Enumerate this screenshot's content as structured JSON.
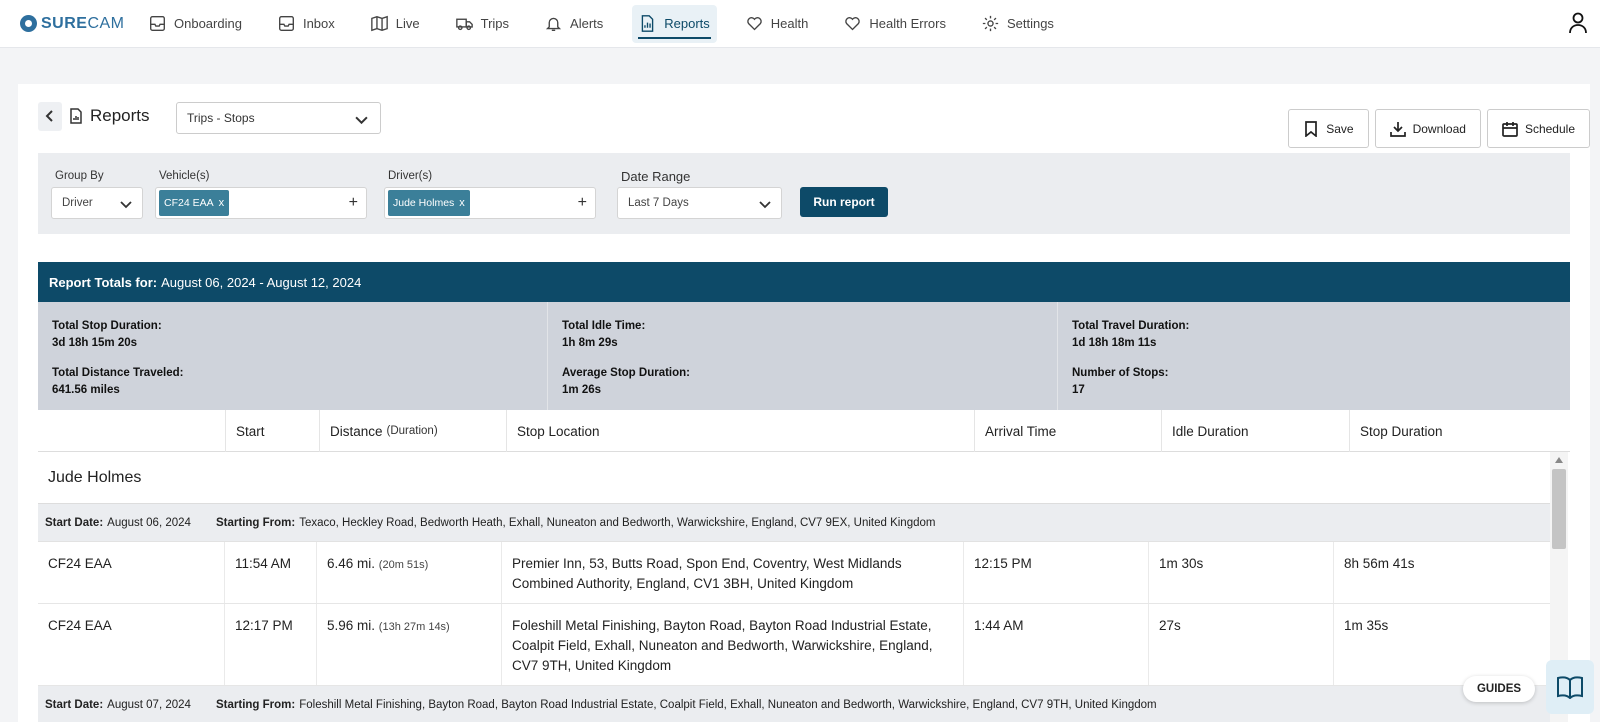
{
  "brand": {
    "name_bold": "SURE",
    "name_rest": "CAM"
  },
  "nav": [
    {
      "label": "Onboarding",
      "icon": "inbox-icon"
    },
    {
      "label": "Inbox",
      "icon": "inbox-icon"
    },
    {
      "label": "Live",
      "icon": "map-icon"
    },
    {
      "label": "Trips",
      "icon": "truck-icon"
    },
    {
      "label": "Alerts",
      "icon": "bell-icon"
    },
    {
      "label": "Reports",
      "icon": "report-icon",
      "active": true
    },
    {
      "label": "Health",
      "icon": "heart-icon"
    },
    {
      "label": "Health Errors",
      "icon": "heart-icon"
    },
    {
      "label": "Settings",
      "icon": "gear-icon"
    }
  ],
  "page": {
    "title": "Reports",
    "report_type": "Trips - Stops"
  },
  "actions": {
    "save": "Save",
    "download": "Download",
    "schedule": "Schedule"
  },
  "filters": {
    "group_by_label": "Group By",
    "group_by_value": "Driver",
    "vehicles_label": "Vehicle(s)",
    "vehicle_chip": "CF24 EAA",
    "drivers_label": "Driver(s)",
    "driver_chip": "Jude Holmes",
    "date_range_label": "Date Range",
    "date_range_value": "Last 7 Days",
    "run_label": "Run report",
    "chip_remove": "x",
    "add": "+"
  },
  "totals": {
    "heading_label": "Report Totals for:",
    "heading_range": "August 06, 2024 - August 12, 2024",
    "total_stop_duration_label": "Total Stop Duration:",
    "total_stop_duration": "3d 18h 15m 20s",
    "total_distance_label": "Total Distance Traveled:",
    "total_distance": "641.56 miles",
    "total_idle_label": "Total Idle Time:",
    "total_idle": "1h 8m 29s",
    "avg_stop_label": "Average Stop Duration:",
    "avg_stop": "1m 26s",
    "total_travel_label": "Total Travel Duration:",
    "total_travel": "1d 18h 18m 11s",
    "num_stops_label": "Number of Stops:",
    "num_stops": "17"
  },
  "table": {
    "columns": {
      "start": "Start",
      "distance": "Distance",
      "distance_sub": "(Duration)",
      "stop_location": "Stop Location",
      "arrival": "Arrival Time",
      "idle": "Idle Duration",
      "stop": "Stop Duration"
    },
    "group_name": "Jude Holmes",
    "start_date_label": "Start Date:",
    "starting_from_label": "Starting From:",
    "day1": {
      "start_date": "August 06, 2024",
      "starting_from": "Texaco, Heckley Road, Bedworth Heath, Exhall, Nuneaton and Bedworth, Warwickshire, England, CV7 9EX, United Kingdom"
    },
    "rows": [
      {
        "vehicle": "CF24 EAA",
        "start": "11:54 AM",
        "distance": "6.46 mi.",
        "duration": "(20m 51s)",
        "location": "Premier Inn, 53, Butts Road, Spon End, Coventry, West Midlands Combined Authority, England, CV1 3BH, United Kingdom",
        "arrival": "12:15 PM",
        "idle": "1m 30s",
        "stop": "8h 56m 41s"
      },
      {
        "vehicle": "CF24 EAA",
        "start": "12:17 PM",
        "distance": "5.96 mi.",
        "duration": "(13h 27m 14s)",
        "location": "Foleshill Metal Finishing, Bayton Road, Bayton Road Industrial Estate, Coalpit Field, Exhall, Nuneaton and Bedworth, Warwickshire, England, CV7 9TH, United Kingdom",
        "arrival": "1:44 AM",
        "idle": "27s",
        "stop": "1m 35s"
      }
    ],
    "day2": {
      "start_date": "August 07, 2024",
      "starting_from": "Foleshill Metal Finishing, Bayton Road, Bayton Road Industrial Estate, Coalpit Field, Exhall, Nuneaton and Bedworth, Warwickshire, England, CV7 9TH, United Kingdom"
    }
  },
  "guides": {
    "label": "GUIDES"
  }
}
